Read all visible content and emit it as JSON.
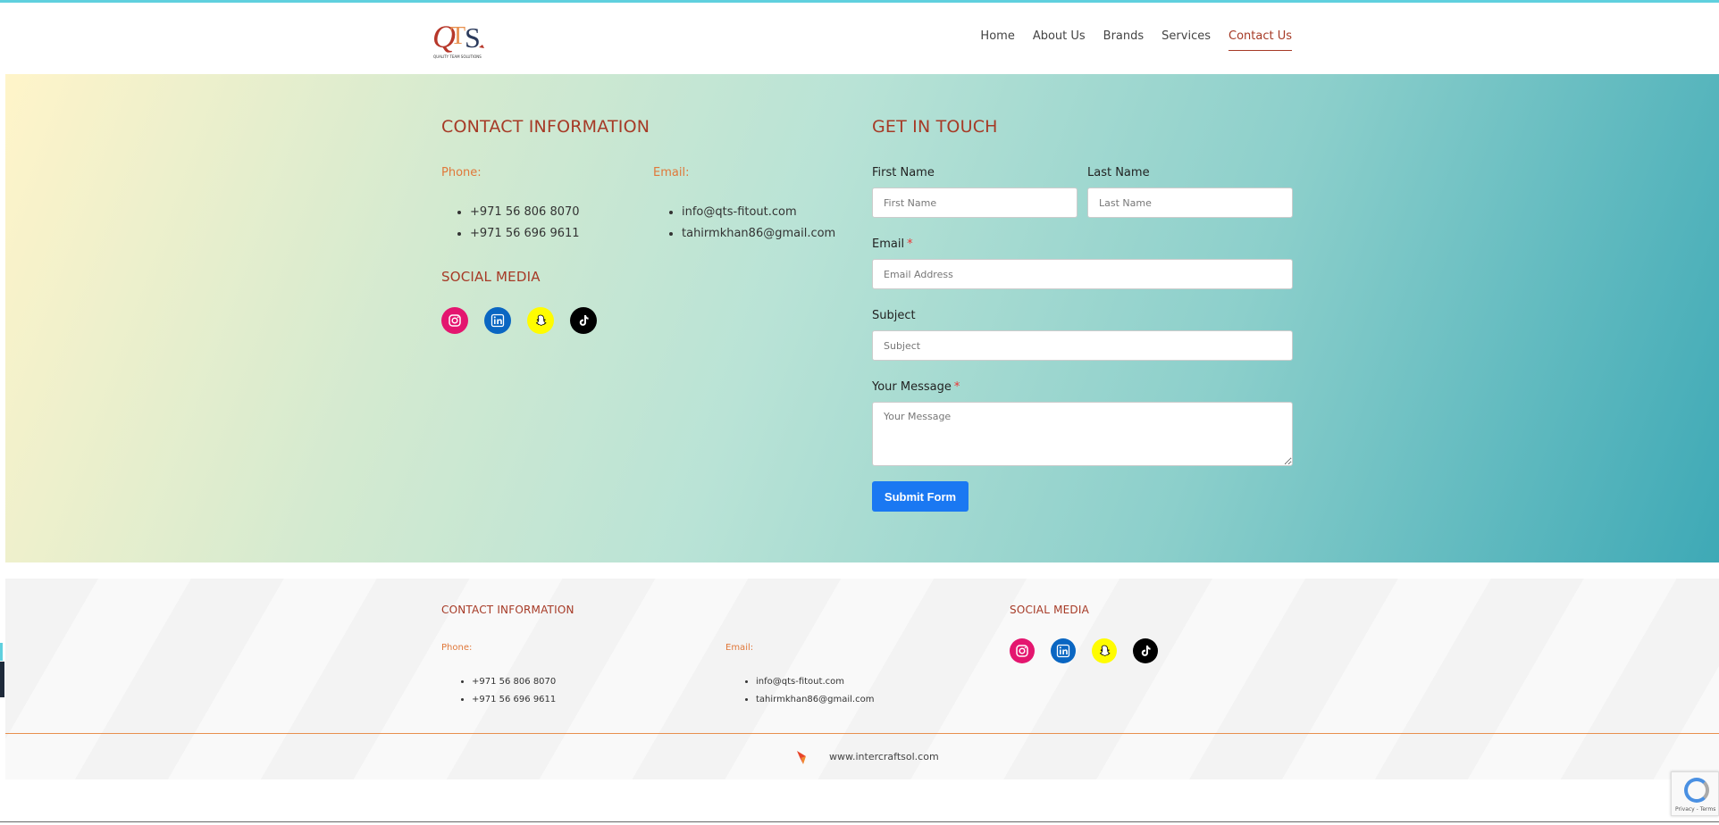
{
  "header": {
    "logo_text": "QTS",
    "logo_tagline": "QUALITY TEAM SOLUTIONS",
    "nav": [
      "Home",
      "About Us",
      "Brands",
      "Services",
      "Contact Us"
    ],
    "active_nav": "Contact Us"
  },
  "contact": {
    "title": "CONTACT INFORMATION",
    "phone_label": "Phone:",
    "email_label": "Email:",
    "phones": [
      "+971 56 806 8070",
      "+971 56 696 9611"
    ],
    "emails": [
      "info@qts-fitout.com",
      "tahirmkhan86@gmail.com"
    ],
    "social_title": "SOCIAL MEDIA",
    "social_icons": [
      "instagram-icon",
      "linkedin-icon",
      "snapchat-icon",
      "tiktok-icon"
    ]
  },
  "form": {
    "title": "GET IN TOUCH",
    "first_name_label": "First Name",
    "first_name_placeholder": "First Name",
    "last_name_label": "Last Name",
    "last_name_placeholder": "Last Name",
    "email_label": "Email",
    "email_placeholder": "Email Address",
    "subject_label": "Subject",
    "subject_placeholder": "Subject",
    "message_label": "Your Message",
    "message_placeholder": "Your Message",
    "required_mark": "*",
    "submit_label": "Submit Form"
  },
  "footer": {
    "contact_title": "CONTACT INFORMATION",
    "phone_label": "Phone:",
    "email_label": "Email:",
    "phones": [
      "+971 56 806 8070",
      "+971 56 696 9611"
    ],
    "emails": [
      "info@qts-fitout.com",
      "tahirmkhan86@gmail.com"
    ],
    "social_title": "SOCIAL MEDIA",
    "site": "www.intercraftsol.com"
  },
  "recaptcha": {
    "text": "Privacy - Terms"
  },
  "colors": {
    "accent": "#a63a26",
    "label_orange": "#e0783a",
    "button": "#1a78f2"
  }
}
